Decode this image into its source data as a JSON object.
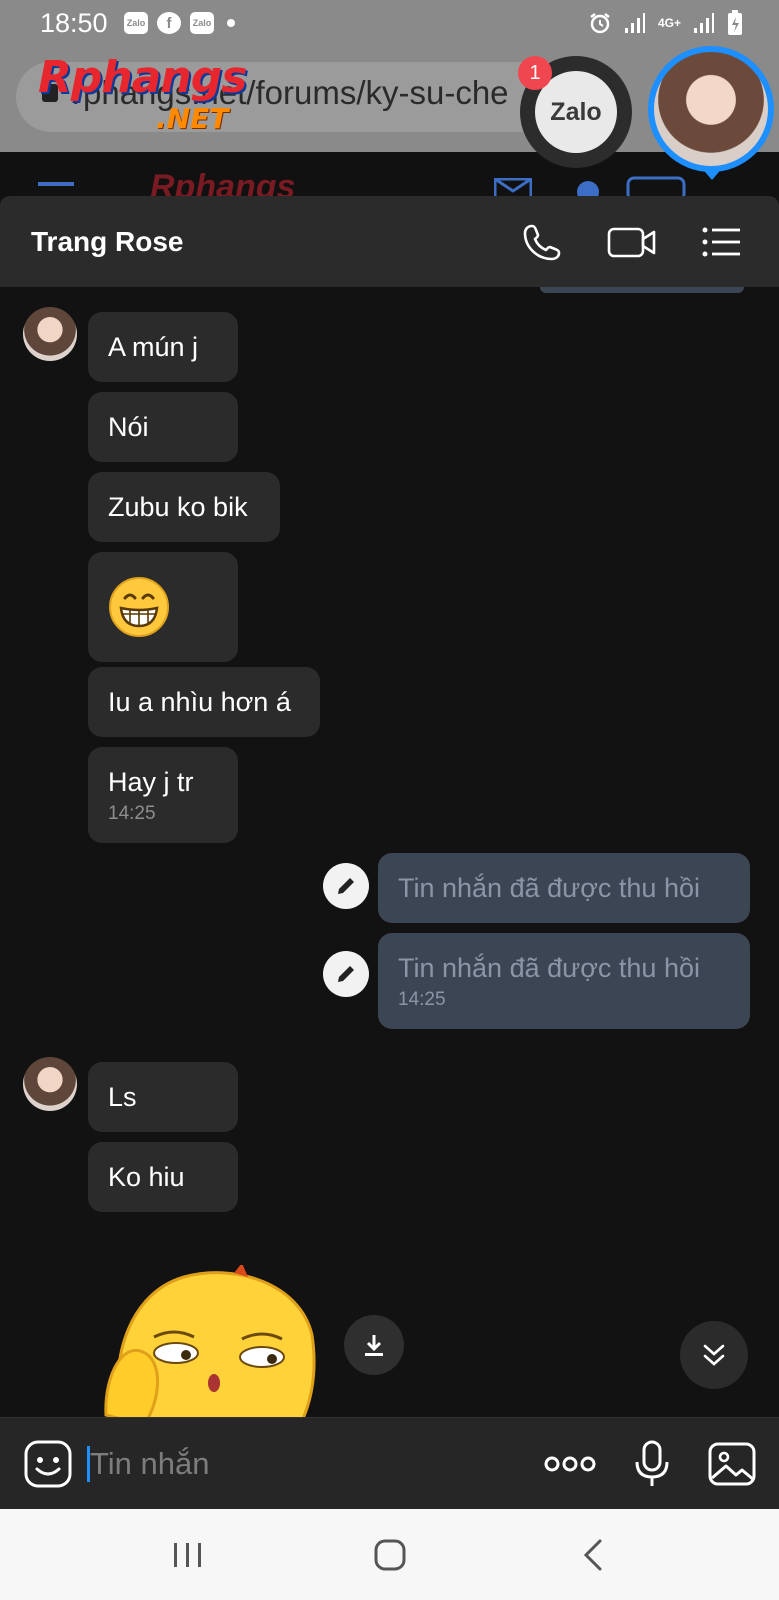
{
  "status_bar": {
    "time": "18:50",
    "notification_apps": [
      "Zalo",
      "f",
      "Zalo"
    ],
    "network": "4G+"
  },
  "browser": {
    "url": "rphangs.net/forums/ky-su-che",
    "site_logo": "Rphangs",
    "site_logo_suffix": ".NET"
  },
  "chat_heads": {
    "zalo_label": "Zalo",
    "zalo_badge": "1"
  },
  "chat": {
    "contact_name": "Trang Rose",
    "received_group_1": [
      {
        "text": "A mún j"
      },
      {
        "text": "Nói"
      },
      {
        "text": "Zubu ko bik"
      },
      {
        "emoji": "grinning-face"
      },
      {
        "text": "Iu a nhìu hơn á"
      },
      {
        "text": "Hay j tr",
        "time": "14:25"
      }
    ],
    "sent": [
      {
        "text": "Tin nhắn đã được thu hồi"
      },
      {
        "text": "Tin nhắn đã được thu hồi",
        "time": "14:25"
      }
    ],
    "received_group_2": [
      {
        "text": "Ls"
      },
      {
        "text": "Ko hiu"
      }
    ]
  },
  "composer": {
    "placeholder": "Tin nhắn"
  },
  "colors": {
    "accent": "#1e8fff",
    "background": "#121212",
    "received_bubble": "#2b2b2b",
    "sent_bubble": "#3c4554"
  }
}
